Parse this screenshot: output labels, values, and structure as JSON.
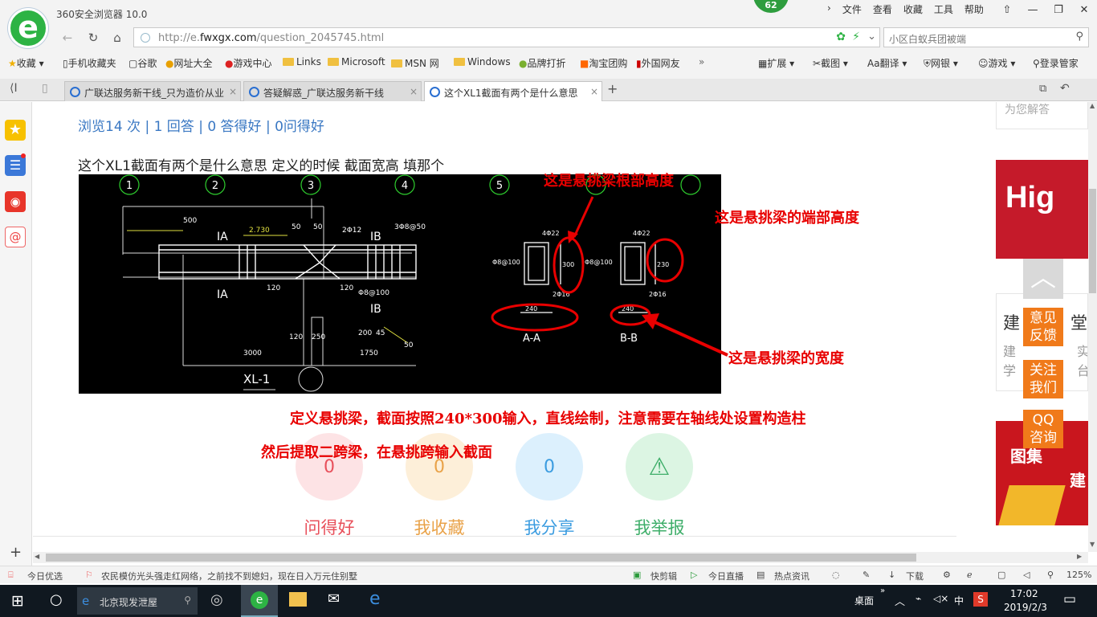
{
  "browser": {
    "title": "360安全浏览器 10.0",
    "badge": "62",
    "menu": [
      "文件",
      "查看",
      "收藏",
      "工具",
      "帮助"
    ],
    "url_prefix": "http://e.",
    "url_domain": "fwxgx.com",
    "url_path": "/question_2045745.html",
    "search_placeholder": "小区白蚁兵团被端"
  },
  "favorites": [
    "收藏",
    "手机收藏夹",
    "谷歌",
    "网址大全",
    "游戏中心",
    "Links",
    "Microsoft",
    "MSN 网",
    "Windows",
    "品牌打折",
    "淘宝团购",
    "外国网友"
  ],
  "tools_bar": [
    "扩展",
    "截图",
    "翻译",
    "网银",
    "游戏",
    "登录管家"
  ],
  "tabs": [
    "广联达服务新干线_只为造价从业",
    "答疑解惑_广联达服务新干线",
    "这个XL1截面有两个是什么意思"
  ],
  "content": {
    "stats": "浏览14 次 | 1 回答 | 0 答得好 | 0问得好",
    "question": "这个XL1截面有两个是什么意思  定义的时候  截面宽高 填那个"
  },
  "cad": {
    "axes": [
      "1",
      "2",
      "3",
      "4",
      "5"
    ],
    "beam_name": "XL-1",
    "sec_a": "A-A",
    "sec_b": "B-B",
    "dims": [
      "500",
      "50",
      "50",
      "120",
      "120",
      "250",
      "120",
      "3000",
      "1750",
      "2Φ12",
      "2.730",
      "3Φ8@50",
      "Φ8@100",
      "240",
      "240",
      "300",
      "230",
      "4Φ22",
      "2Φ16",
      "2Φ16",
      "200",
      "45",
      "50",
      "Φ8@100",
      "Φ8@100"
    ],
    "labels": [
      "IA",
      "IA",
      "IB",
      "IB"
    ]
  },
  "notes": {
    "root_height": "这是悬挑梁根部高度",
    "end_height": "这是悬挑梁的端部高度",
    "width": "这是悬挑梁的宽度",
    "answer1": "定义悬挑梁，截面按照240*300输入，直线绘制，注意需要在轴线处设置构造柱",
    "answer2": "然后提取二跨梁，在悬挑跨输入截面"
  },
  "actions": [
    {
      "label": "问得好",
      "count": "0",
      "color": "#e8505b",
      "bg": "#fde3e5"
    },
    {
      "label": "我收藏",
      "count": "0",
      "color": "#e9a248",
      "bg": "#fdefd9"
    },
    {
      "label": "我分享",
      "count": "0",
      "color": "#3b9ce0",
      "bg": "#dcf0fd"
    },
    {
      "label": "我举报",
      "count": "",
      "color": "#3fae6a",
      "bg": "#dcf5e3"
    }
  ],
  "right_panel": {
    "top_text": "为您解答",
    "banner_text": "Hig",
    "card_title": "建",
    "card_title2": "堂",
    "card_lines": [
      "建",
      "学"
    ],
    "card_lines2": [
      "实",
      "台"
    ],
    "feedback": "意见反馈",
    "follow": "关注我们",
    "qq": "QQ咨询",
    "promo_text": "图集",
    "promo_text2": "建"
  },
  "statusbar": {
    "left": "今日优选",
    "news": "农民模仿光头强走红网络，之前找不到媳妇，现在日入万元住别墅",
    "items": [
      "快剪辑",
      "今日直播",
      "热点资讯",
      "下载"
    ],
    "zoom": "125%"
  },
  "taskbar": {
    "search": "北京现发泄屋",
    "desktop": "桌面",
    "ime": "中",
    "time": "17:02",
    "date": "2019/2/3"
  },
  "colors": {
    "link": "#3a78c3",
    "note_red": "#e80000",
    "orange": "#f07a1a"
  }
}
